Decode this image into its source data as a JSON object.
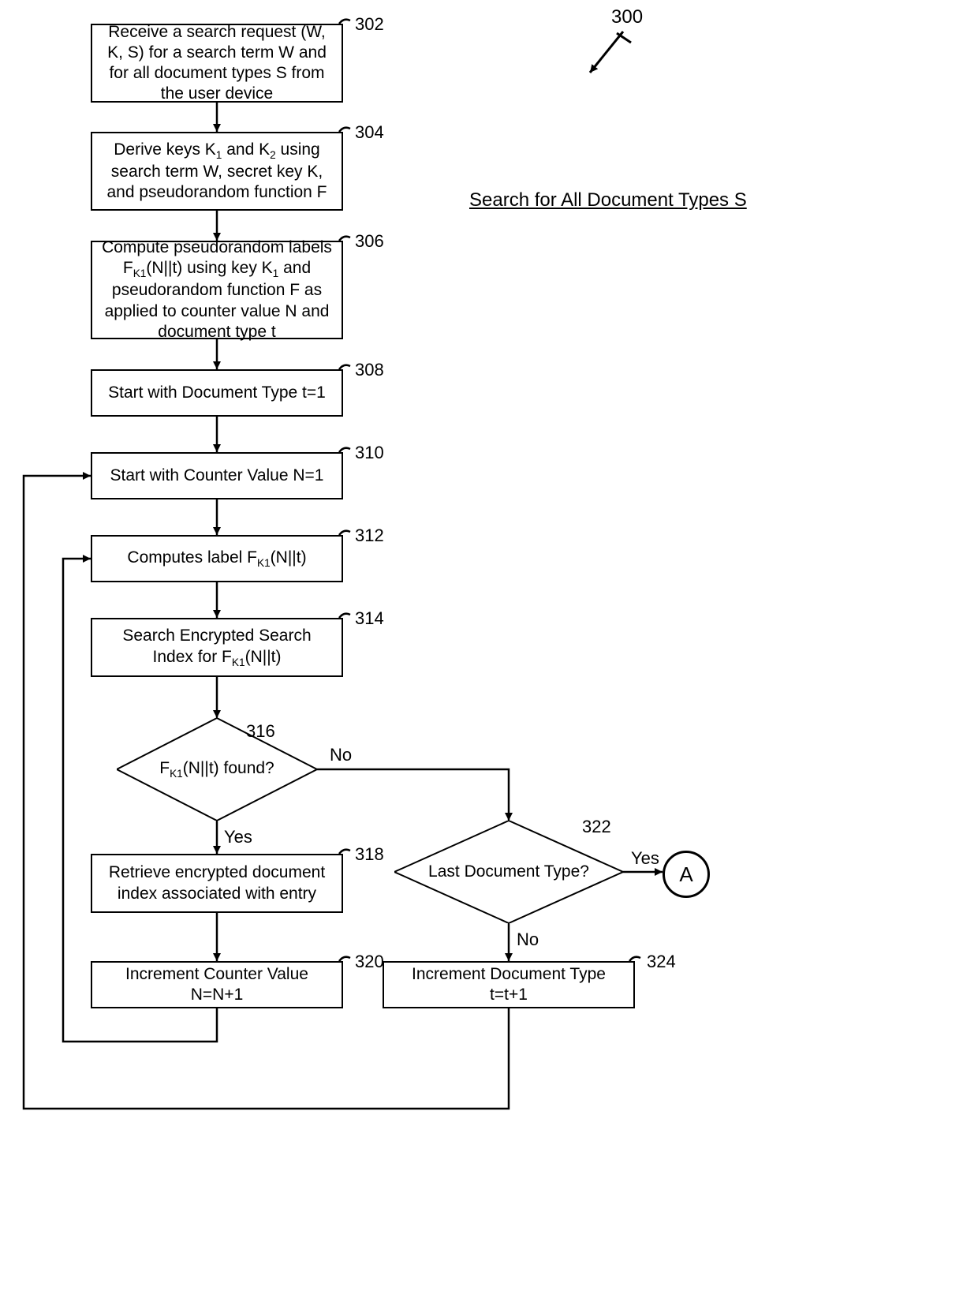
{
  "figure_label": "300",
  "title": "Search for All Document Types S",
  "nodes": {
    "n302": {
      "ref": "302",
      "text": "Receive a search request (W, K, S) for a search term W and for all document types S from the user device"
    },
    "n304": {
      "ref": "304",
      "text_html": "Derive keys K<span class='sub'>1</span> and K<span class='sub'>2</span> using search term W, secret key K, and pseudorandom function F"
    },
    "n306": {
      "ref": "306",
      "text_html": "Compute pseudorandom labels F<span class='sub'>K1</span>(N||t) using key K<span class='sub'>1</span> and pseudorandom function F as applied to counter value N and document type t"
    },
    "n308": {
      "ref": "308",
      "text": "Start with Document Type t=1"
    },
    "n310": {
      "ref": "310",
      "text": "Start with Counter Value N=1"
    },
    "n312": {
      "ref": "312",
      "text_html": "Computes label F<span class='sub'>K1</span>(N||t)"
    },
    "n314": {
      "ref": "314",
      "text_html": "Search Encrypted Search Index for F<span class='sub'>K1</span>(N||t)"
    },
    "n316": {
      "ref": "316",
      "question_html": "F<span class='sub'>K1</span>(N||t) found?",
      "yes": "Yes",
      "no": "No"
    },
    "n318": {
      "ref": "318",
      "text": "Retrieve encrypted document index associated with entry"
    },
    "n320": {
      "ref": "320",
      "text": "Increment Counter Value N=N+1"
    },
    "n322": {
      "ref": "322",
      "question": "Last Document Type?",
      "yes": "Yes",
      "no": "No"
    },
    "n324": {
      "ref": "324",
      "text": "Increment Document Type t=t+1"
    },
    "connA": {
      "label": "A"
    }
  }
}
